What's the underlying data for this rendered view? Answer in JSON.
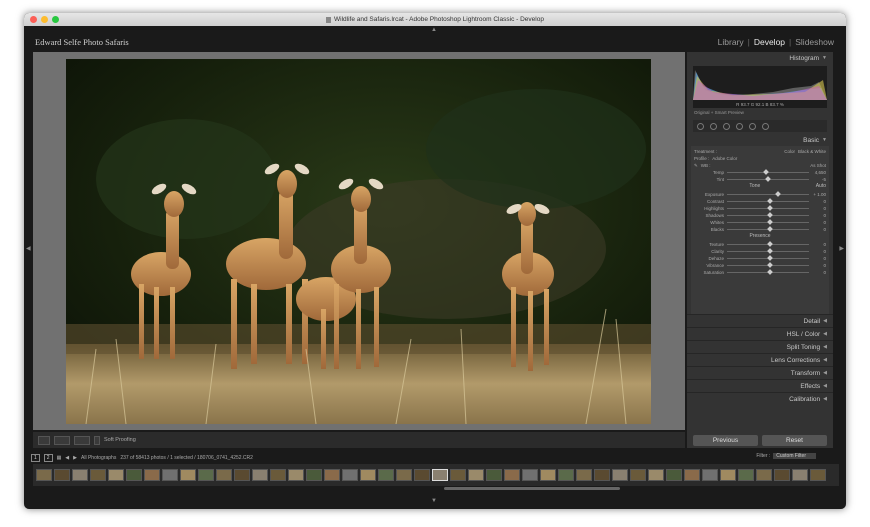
{
  "window": {
    "title": "Wildlife and Safaris.lrcat - Adobe Photoshop Lightroom Classic - Develop",
    "identity_plate": "Edward Selfe Photo Safaris",
    "modules": [
      "Library",
      "Develop",
      "Slideshow"
    ],
    "active_module": "Develop"
  },
  "right_panel": {
    "histogram_label": "Histogram",
    "histogram_values": {
      "r_label": "R",
      "r": "93.7",
      "g_label": "G",
      "g": "92.1",
      "b_label": "B",
      "b": "83.7 %"
    },
    "original_label": "Original + Smart Preview",
    "basic_label": "Basic",
    "treatment_label": "Treatment :",
    "treatment_color": "Color",
    "treatment_bw": "Black & White",
    "profile_label": "Profile :",
    "profile_value": "Adobe Color",
    "wb_label": "WB :",
    "wb_value": "As Shot",
    "tone_label": "Tone",
    "tone_auto": "Auto",
    "presence_label": "Presence",
    "sliders_wb": [
      {
        "label": "Temp",
        "value": "4,650",
        "pos": 0.45
      },
      {
        "label": "Tint",
        "value": "-5",
        "pos": 0.47
      }
    ],
    "sliders_tone": [
      {
        "label": "Exposure",
        "value": "+ 1.00",
        "pos": 0.6
      },
      {
        "label": "Contrast",
        "value": "0",
        "pos": 0.5
      },
      {
        "label": "Highlights",
        "value": "0",
        "pos": 0.5
      },
      {
        "label": "Shadows",
        "value": "0",
        "pos": 0.5
      },
      {
        "label": "Whites",
        "value": "0",
        "pos": 0.5
      },
      {
        "label": "Blacks",
        "value": "0",
        "pos": 0.5
      }
    ],
    "sliders_presence": [
      {
        "label": "Texture",
        "value": "0",
        "pos": 0.5
      },
      {
        "label": "Clarity",
        "value": "0",
        "pos": 0.5
      },
      {
        "label": "Dehaze",
        "value": "0",
        "pos": 0.5
      },
      {
        "label": "Vibrance",
        "value": "0",
        "pos": 0.5
      },
      {
        "label": "Saturation",
        "value": "0",
        "pos": 0.5
      }
    ],
    "collapsed_panels": [
      "Detail",
      "HSL / Color",
      "Split Toning",
      "Lens Corrections",
      "Transform",
      "Effects",
      "Calibration"
    ],
    "previous_button": "Previous",
    "reset_button": "Reset"
  },
  "toolbar": {
    "soft_proofing": "Soft Proofing"
  },
  "filmbar": {
    "page1": "1",
    "page2": "2",
    "source": "All Photographs",
    "count": "237 of 58413 photos / 1 selected / 180706_0741_4252.CR2",
    "filter_label": "Filter :",
    "filter_value": "Custom Filter"
  },
  "colors": {
    "accent": "#e8e8e8",
    "panel_bg": "#333333"
  }
}
